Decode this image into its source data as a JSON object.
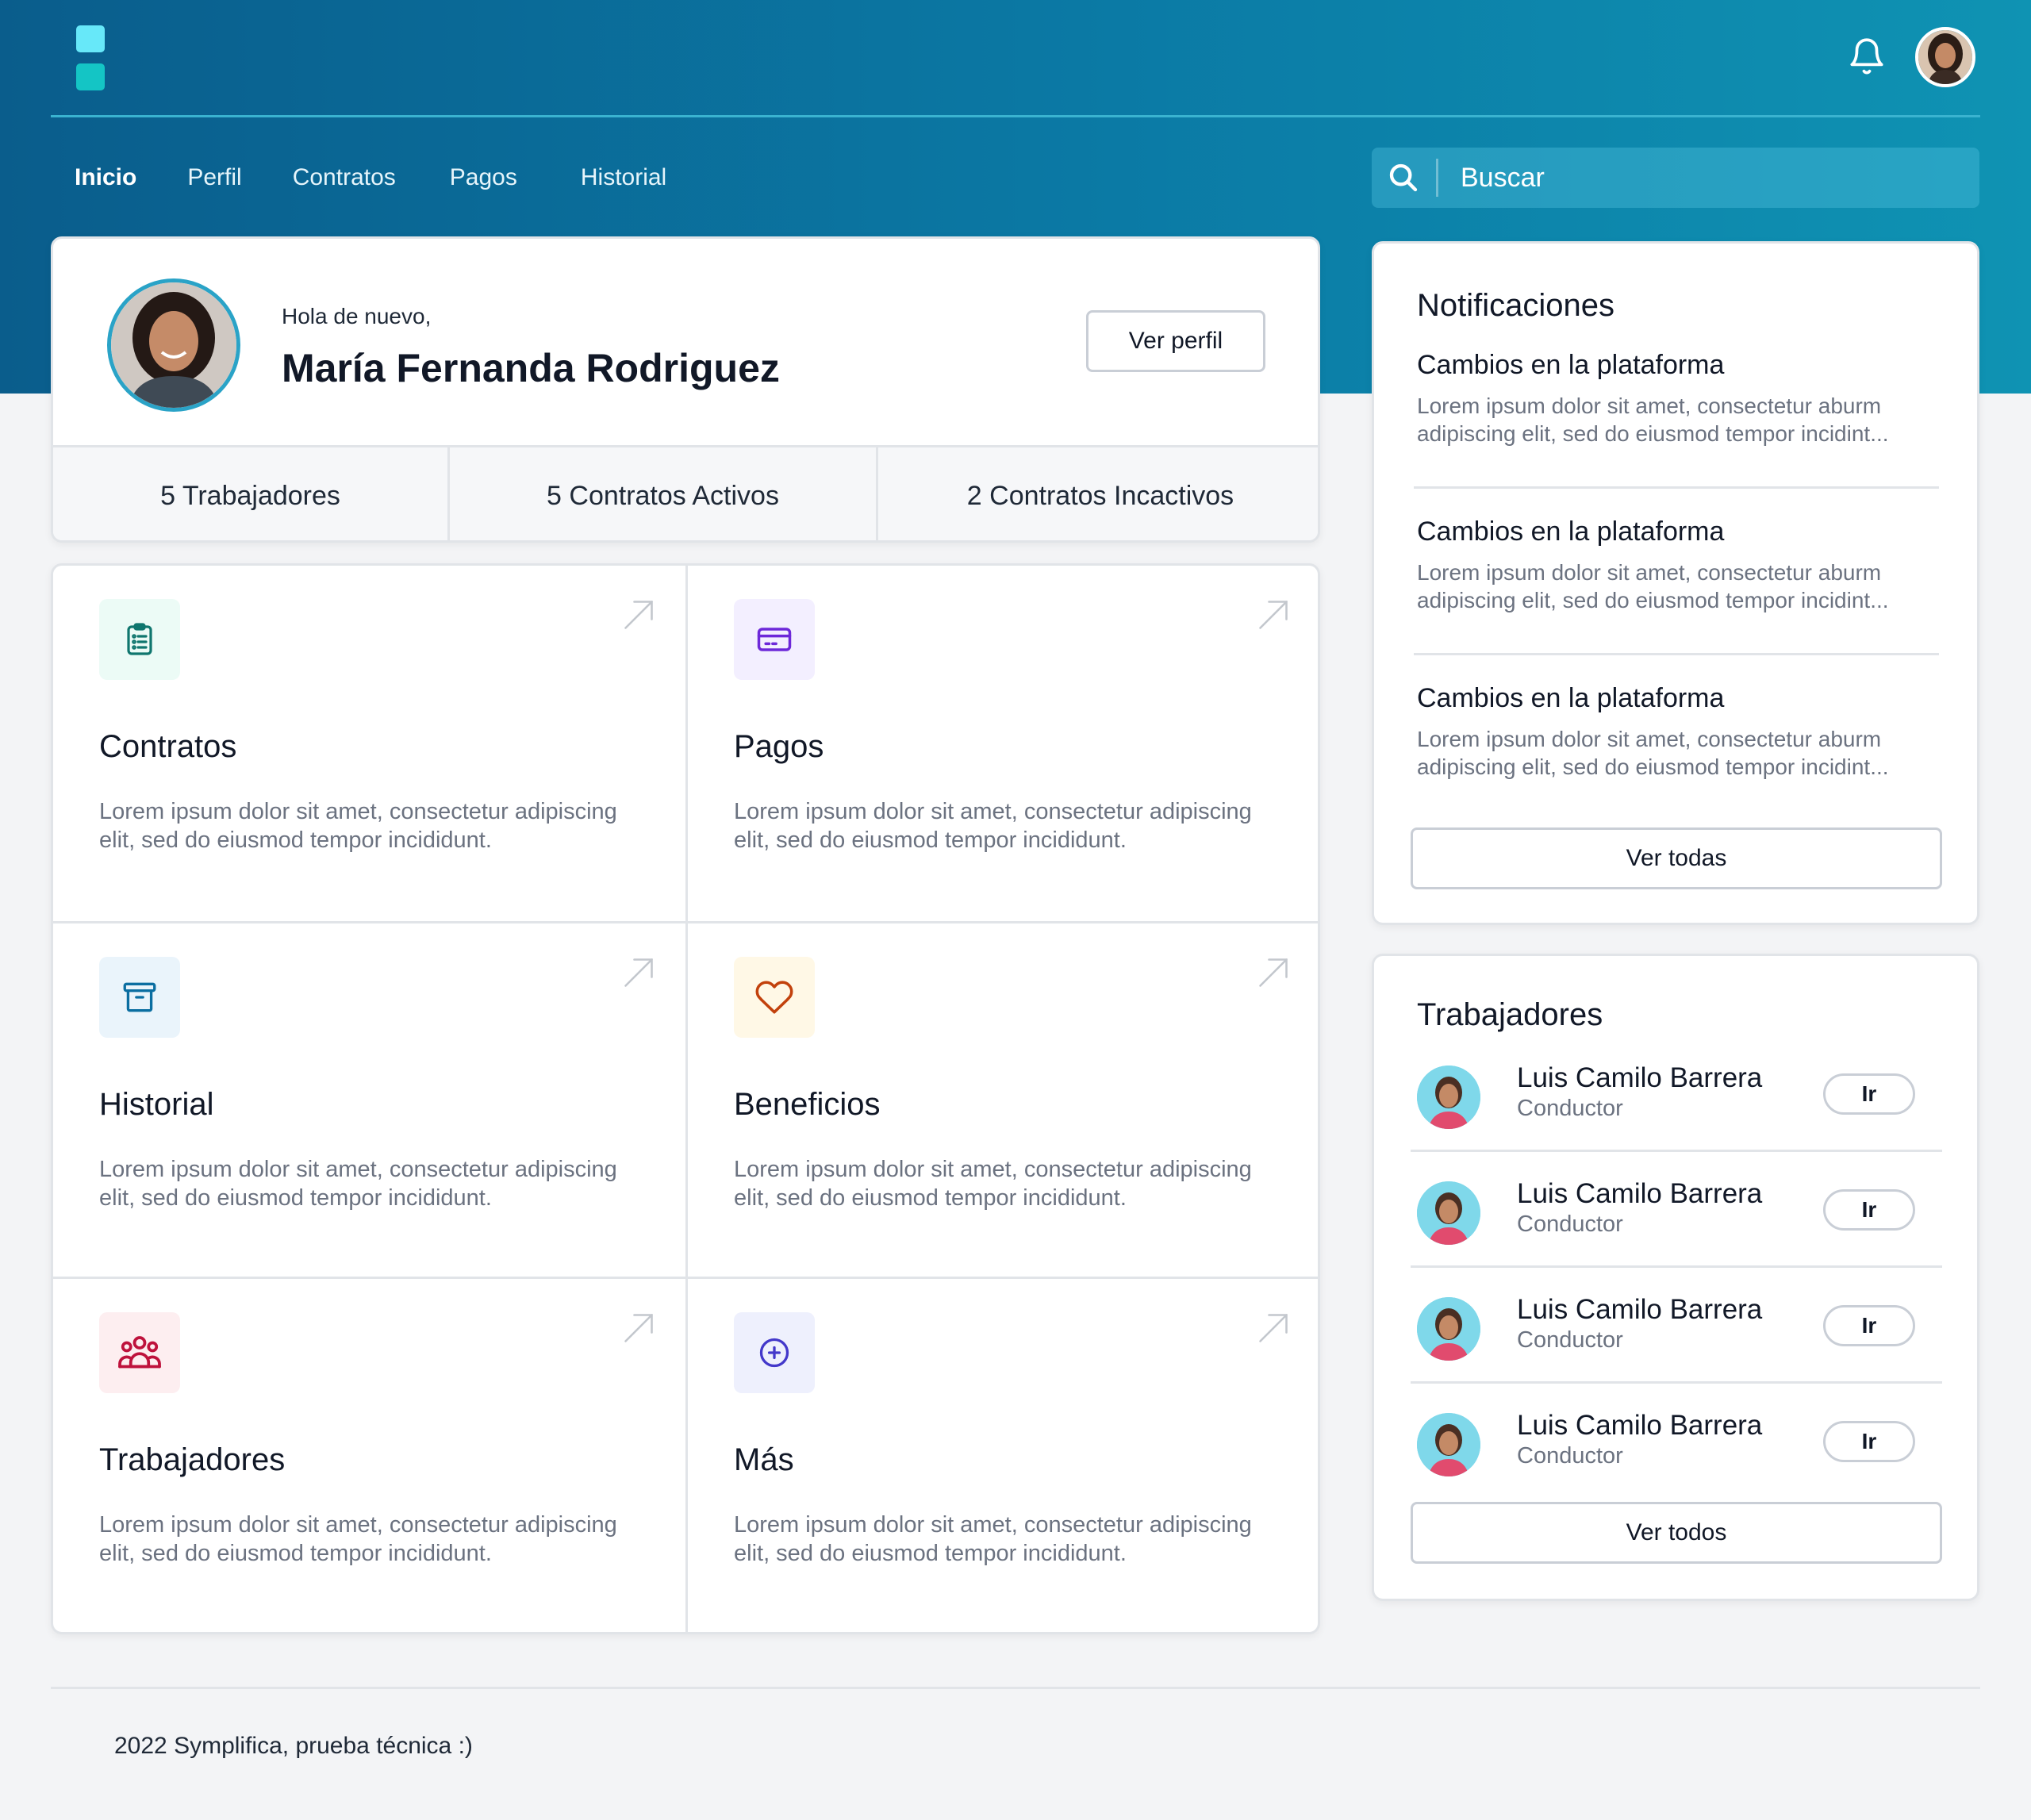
{
  "header": {
    "logo": "app-logo",
    "bell_icon": "bell-icon",
    "avatar": "user-avatar",
    "colors": {
      "hero_start": "#0a5d8c",
      "hero_end": "#0f93b3",
      "logo_top": "#67e8f9",
      "logo_bottom": "#14c5c5"
    }
  },
  "nav": {
    "items": [
      {
        "label": "Inicio",
        "active": true
      },
      {
        "label": "Perfil"
      },
      {
        "label": "Contratos"
      },
      {
        "label": "Pagos"
      },
      {
        "label": "Historial"
      }
    ]
  },
  "search": {
    "icon": "search-icon",
    "placeholder": "Buscar"
  },
  "profile": {
    "greeting": "Hola de nuevo,",
    "name": "María Fernanda Rodriguez",
    "view_profile_label": "Ver perfil",
    "stats": [
      "5 Trabajadores",
      "5 Contratos Activos",
      "2 Contratos Incactivos"
    ]
  },
  "tiles": [
    {
      "title": "Contratos",
      "desc": "Lorem ipsum dolor sit amet, consectetur adipiscing elit, sed do eiusmod tempor incididunt.",
      "icon": "clipboard-icon",
      "icon_color": "#0f766e",
      "icon_bg": "#ecfbf6"
    },
    {
      "title": "Pagos",
      "desc": "Lorem ipsum dolor sit amet, consectetur adipiscing elit, sed do eiusmod tempor incididunt.",
      "icon": "credit-card-icon",
      "icon_color": "#6d28d9",
      "icon_bg": "#f3efff"
    },
    {
      "title": "Historial",
      "desc": "Lorem ipsum dolor sit amet, consectetur adipiscing elit, sed do eiusmod tempor incididunt.",
      "icon": "archive-icon",
      "icon_color": "#0b6ea1",
      "icon_bg": "#eaf4fb"
    },
    {
      "title": "Beneficios",
      "desc": "Lorem ipsum dolor sit amet, consectetur adipiscing elit, sed do eiusmod tempor incididunt.",
      "icon": "heart-icon",
      "icon_color": "#c2410c",
      "icon_bg": "#fff8e6"
    },
    {
      "title": "Trabajadores",
      "desc": "Lorem ipsum dolor sit amet, consectetur adipiscing elit, sed do eiusmod tempor incididunt.",
      "icon": "users-icon",
      "icon_color": "#be123c",
      "icon_bg": "#fdeef0"
    },
    {
      "title": "Más",
      "desc": "Lorem ipsum dolor sit amet, consectetur adipiscing elit, sed do eiusmod tempor incididunt.",
      "icon": "plus-circle-icon",
      "icon_color": "#4338ca",
      "icon_bg": "#eef0fd"
    }
  ],
  "notifications": {
    "title": "Notificaciones",
    "items": [
      {
        "title": "Cambios en la plataforma",
        "body": "Lorem ipsum dolor sit amet, consectetur aburm adipiscing elit, sed do eiusmod tempor incidint..."
      },
      {
        "title": "Cambios en la plataforma",
        "body": "Lorem ipsum dolor sit amet, consectetur aburm adipiscing elit, sed do eiusmod tempor incidint..."
      },
      {
        "title": "Cambios en la plataforma",
        "body": "Lorem ipsum dolor sit amet, consectetur aburm adipiscing elit, sed do eiusmod tempor incidint..."
      }
    ],
    "view_all_label": "Ver todas"
  },
  "workers": {
    "title": "Trabajadores",
    "items": [
      {
        "name": "Luis Camilo Barrera",
        "role": "Conductor",
        "action": "Ir"
      },
      {
        "name": "Luis Camilo Barrera",
        "role": "Conductor",
        "action": "Ir"
      },
      {
        "name": "Luis Camilo Barrera",
        "role": "Conductor",
        "action": "Ir"
      },
      {
        "name": "Luis Camilo Barrera",
        "role": "Conductor",
        "action": "Ir"
      }
    ],
    "view_all_label": "Ver todos"
  },
  "footer": {
    "text": "2022 Symplifica, prueba técnica :)"
  }
}
